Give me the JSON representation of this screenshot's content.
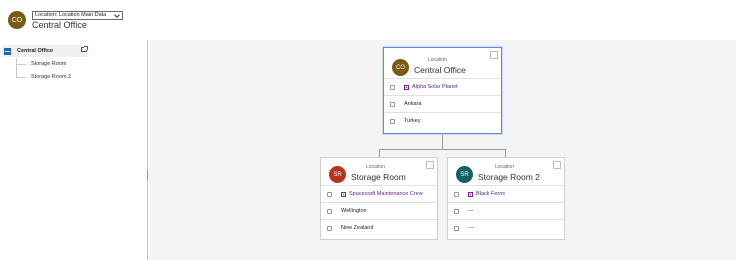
{
  "header": {
    "avatar_initials": "CO",
    "avatar_color": "#7a5b14",
    "form_selector": "Location: Location Main Data",
    "record_title": "Central Office"
  },
  "tree": {
    "root": "Central Office",
    "children": [
      "Storage Room",
      "Storage Room 2"
    ]
  },
  "cards": {
    "root": {
      "initials": "CO",
      "color": "#7a5b14",
      "type": "Location",
      "name": "Central Office",
      "field1": "Alpha Solar Planet",
      "field2": "Ankara",
      "field3": "Turkey"
    },
    "child1": {
      "initials": "SR",
      "color": "#b8321c",
      "type": "Location",
      "name": "Storage Room",
      "field1": "Spacecraft Maintenance Crew",
      "field2": "Wellington",
      "field3": "New Zealand"
    },
    "child2": {
      "initials": "SR",
      "color": "#176066",
      "type": "Location",
      "name": "Storage Room 2",
      "field1": "Black Ferns",
      "field2": "---",
      "field3": "---"
    }
  },
  "colors": {
    "accent": "#2266b8",
    "link": "#5a1f8a",
    "selected_border": "#5b8ed6"
  }
}
